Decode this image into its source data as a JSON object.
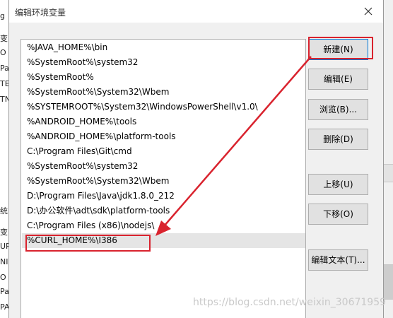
{
  "dialog": {
    "title": "编辑环境变量",
    "close_label": "×"
  },
  "background_left": [
    "g",
    "变",
    "O",
    "Pa",
    "TE",
    "TN",
    "统",
    "变",
    "UR",
    "NI",
    "O",
    "Pa",
    "PA"
  ],
  "list": {
    "items": [
      "%JAVA_HOME%\\bin",
      "%SystemRoot%\\system32",
      "%SystemRoot%",
      "%SystemRoot%\\System32\\Wbem",
      "%SYSTEMROOT%\\System32\\WindowsPowerShell\\v1.0\\",
      "%ANDROID_HOME%\\tools",
      "%ANDROID_HOME%\\platform-tools",
      "C:\\Program Files\\Git\\cmd",
      "%SystemRoot%\\system32",
      "%SystemRoot%\\System32\\Wbem",
      "D:\\Program Files\\Java\\jdk1.8.0_212",
      "D:\\办公软件\\adt\\sdk\\platform-tools",
      "C:\\Program Files (x86)\\nodejs\\",
      "%CURL_HOME%\\I386"
    ],
    "selected_index": 13
  },
  "buttons": {
    "new": "新建(N)",
    "edit": "编辑(E)",
    "browse": "浏览(B)...",
    "delete": "删除(D)",
    "move_up": "上移(U)",
    "move_down": "下移(O)",
    "edit_text": "编辑文本(T)..."
  },
  "watermark": "https://blog.csdn.net/weixin_30671959",
  "colors": {
    "highlight_red": "#d9232e",
    "selected_row": "#e5e5e5",
    "button_bg": "#e1e1e1"
  }
}
